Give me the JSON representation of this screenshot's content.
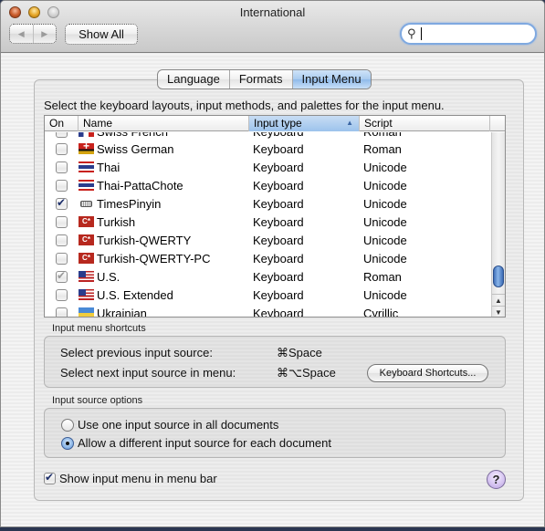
{
  "window": {
    "title": "International"
  },
  "toolbar": {
    "back_icon": "back-arrow-icon",
    "forward_icon": "forward-arrow-icon",
    "show_all_label": "Show All",
    "search_value": "",
    "search_icon": "magnifier-icon"
  },
  "tabs": [
    {
      "label": "Language",
      "active": false
    },
    {
      "label": "Formats",
      "active": false
    },
    {
      "label": "Input Menu",
      "active": true
    }
  ],
  "instruction": "Select the keyboard layouts, input methods, and palettes for the input menu.",
  "table": {
    "columns": [
      {
        "label": "On"
      },
      {
        "label": "Name"
      },
      {
        "label": "Input type",
        "sorted": "ascending"
      },
      {
        "label": "Script"
      }
    ],
    "rows": [
      {
        "on": false,
        "disabled": false,
        "flag": "swiss-french-flag",
        "name": "Swiss French",
        "type": "Keyboard",
        "script": "Roman",
        "partial": true
      },
      {
        "on": false,
        "disabled": false,
        "flag": "swiss-german-flag",
        "name": "Swiss German",
        "type": "Keyboard",
        "script": "Roman"
      },
      {
        "on": false,
        "disabled": false,
        "flag": "thai-flag",
        "name": "Thai",
        "type": "Keyboard",
        "script": "Unicode"
      },
      {
        "on": false,
        "disabled": false,
        "flag": "thai-flag",
        "name": "Thai-PattaChote",
        "type": "Keyboard",
        "script": "Unicode"
      },
      {
        "on": true,
        "disabled": false,
        "flag": "keyboard-icon",
        "name": "TimesPinyin",
        "type": "Keyboard",
        "script": "Unicode"
      },
      {
        "on": false,
        "disabled": false,
        "flag": "turkish-flag",
        "name": "Turkish",
        "type": "Keyboard",
        "script": "Unicode"
      },
      {
        "on": false,
        "disabled": false,
        "flag": "turkish-flag",
        "name": "Turkish-QWERTY",
        "type": "Keyboard",
        "script": "Unicode"
      },
      {
        "on": false,
        "disabled": false,
        "flag": "turkish-flag",
        "name": "Turkish-QWERTY-PC",
        "type": "Keyboard",
        "script": "Unicode"
      },
      {
        "on": true,
        "disabled": true,
        "flag": "us-flag",
        "name": "U.S.",
        "type": "Keyboard",
        "script": "Roman"
      },
      {
        "on": false,
        "disabled": false,
        "flag": "us-flag",
        "name": "U.S. Extended",
        "type": "Keyboard",
        "script": "Unicode"
      },
      {
        "on": false,
        "disabled": false,
        "flag": "ukraine-flag",
        "name": "Ukrainian",
        "type": "Keyboard",
        "script": "Cyrillic"
      }
    ],
    "turkish_flag_text": "C*"
  },
  "shortcuts": {
    "group_label": "Input menu shortcuts",
    "previous_label": "Select previous input source:",
    "previous_keys": "⌘Space",
    "next_label": "Select next input source in menu:",
    "next_keys": "⌘⌥Space",
    "keyboard_shortcuts_button": "Keyboard Shortcuts..."
  },
  "source_options": {
    "group_label": "Input source options",
    "options": [
      {
        "label": "Use one input source in all documents",
        "selected": false
      },
      {
        "label": "Allow a different input source for each document",
        "selected": true
      }
    ]
  },
  "show_menu": {
    "label": "Show input menu in menu bar",
    "checked": true
  },
  "help_label": "?"
}
